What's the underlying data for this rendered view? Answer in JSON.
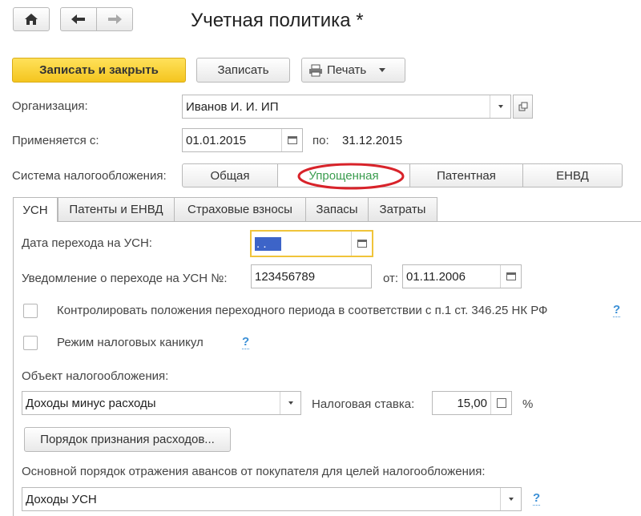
{
  "window": {
    "title": "Учетная политика *"
  },
  "toolbar": {
    "save_close": "Записать и закрыть",
    "save": "Записать",
    "print": "Печать"
  },
  "org": {
    "label": "Организация:",
    "value": "Иванов И. И. ИП"
  },
  "period": {
    "label": "Применяется с:",
    "from": "01.01.2015",
    "to_label": "по:",
    "to": "31.12.2015"
  },
  "tax_system": {
    "label": "Система налогообложения:",
    "options": [
      "Общая",
      "Упрощенная",
      "Патентная",
      "ЕНВД"
    ],
    "selected": "Упрощенная",
    "highlight_color": "#d8232a"
  },
  "tabs": [
    "УСН",
    "Патенты и ЕНВД",
    "Страховые взносы",
    "Запасы",
    "Затраты"
  ],
  "usn": {
    "transition_date_label": "Дата перехода на УСН:",
    "transition_date_value": " .  .",
    "notice_label": "Уведомление о переходе на УСН №:",
    "notice_number": "123456789",
    "notice_from_label": "от:",
    "notice_date": "01.11.2006",
    "control_transition_label": "Контролировать положения переходного периода в соответствии с п.1 ст. 346.25 НК РФ",
    "tax_holidays_label": "Режим налоговых каникул",
    "help": "?",
    "object_label": "Объект налогообложения:",
    "object_value": "Доходы минус расходы",
    "rate_label": "Налоговая ставка:",
    "rate_value": "15,00",
    "rate_unit": "%",
    "expenses_button": "Порядок признания расходов...",
    "advances_label": "Основной порядок отражения авансов от покупателя для целей налогообложения:",
    "advances_value": "Доходы УСН"
  }
}
